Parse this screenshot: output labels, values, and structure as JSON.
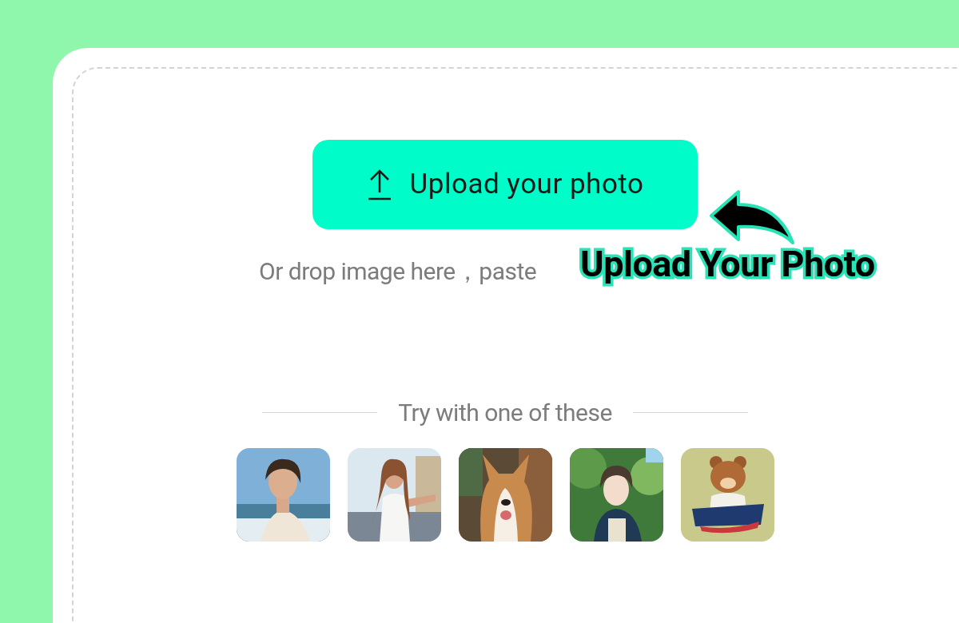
{
  "upload_button": {
    "label": "Upload your photo"
  },
  "drop_hint": "Or drop image here，paste",
  "samples": {
    "heading": "Try with one of these"
  },
  "annotation": {
    "label": "Upload Your Photo"
  }
}
